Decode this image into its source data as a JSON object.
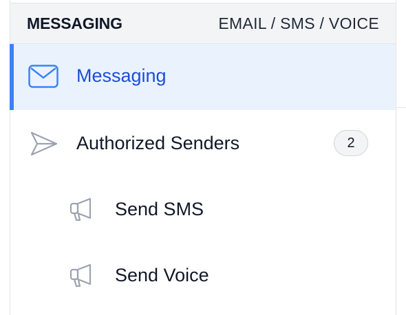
{
  "header": {
    "title": "MESSAGING",
    "subtitle": "EMAIL / SMS / VOICE"
  },
  "nav": {
    "items": [
      {
        "label": "Messaging",
        "icon": "envelope-icon",
        "active": true
      },
      {
        "label": "Authorized Senders",
        "icon": "send-icon",
        "badge": "2"
      },
      {
        "label": "Send SMS",
        "icon": "megaphone-icon"
      },
      {
        "label": "Send Voice",
        "icon": "megaphone-icon"
      }
    ]
  },
  "colors": {
    "accent": "#3b82f6",
    "active_bg": "#eaf2fe",
    "active_text": "#1d4ed8"
  }
}
